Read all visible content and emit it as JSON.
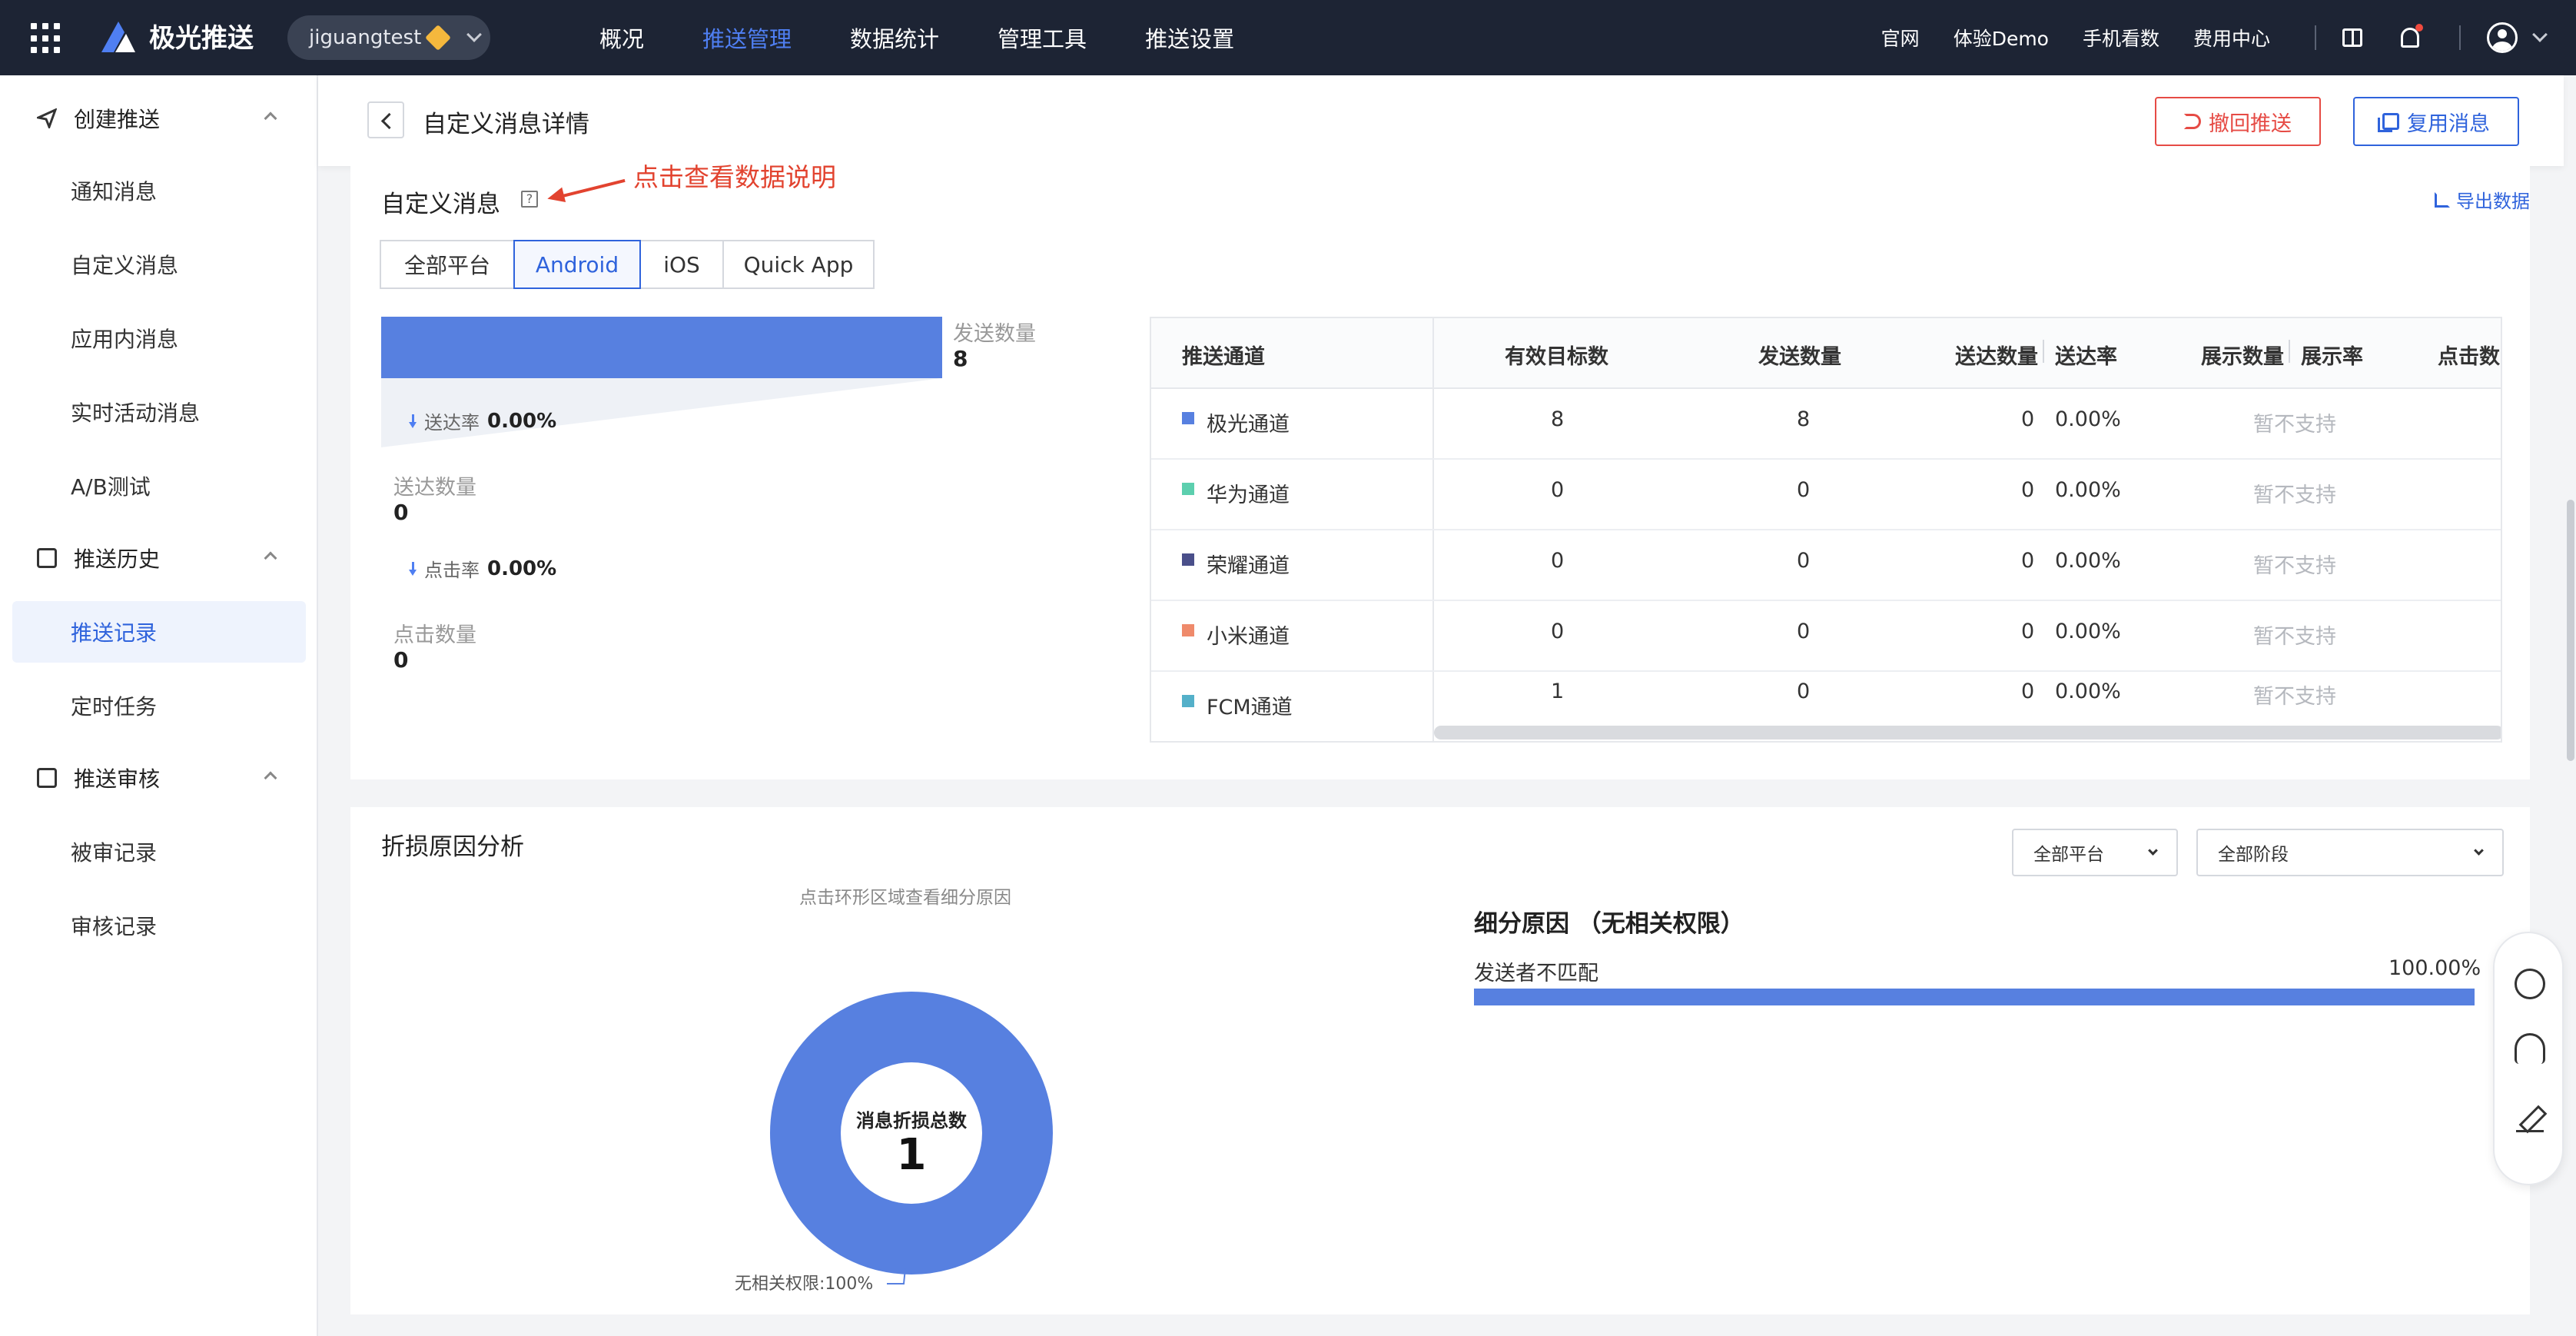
{
  "topbar": {
    "logo_text": "极光推送",
    "account": "jiguangtest",
    "nav": [
      "概况",
      "推送管理",
      "数据统计",
      "管理工具",
      "推送设置"
    ],
    "active_nav": "推送管理",
    "links": [
      "官网",
      "体验Demo",
      "手机看数",
      "费用中心"
    ]
  },
  "sidebar": {
    "groups": [
      {
        "title": "创建推送",
        "items": [
          "通知消息",
          "自定义消息",
          "应用内消息",
          "实时活动消息",
          "A/B测试"
        ]
      },
      {
        "title": "推送历史",
        "items": [
          "推送记录",
          "定时任务"
        ]
      },
      {
        "title": "推送审核",
        "items": [
          "被审记录",
          "审核记录"
        ]
      }
    ],
    "active_item": "推送记录"
  },
  "header": {
    "title": "自定义消息详情",
    "revoke_label": "撤回推送",
    "reuse_label": "复用消息"
  },
  "summary": {
    "title": "自定义消息",
    "help_glyph": "?",
    "annotation": "点击查看数据说明",
    "export_label": "导出数据",
    "tabs": [
      "全部平台",
      "Android",
      "iOS",
      "Quick App"
    ],
    "active_tab": "Android",
    "funnel": {
      "sent_label": "发送数量",
      "sent_value": "8",
      "delivery_rate_label": "送达率",
      "delivery_rate": "0.00%",
      "delivered_label": "送达数量",
      "delivered_value": "0",
      "click_rate_label": "点击率",
      "click_rate": "0.00%",
      "clicks_label": "点击数量",
      "clicks_value": "0"
    },
    "table": {
      "headers": [
        "推送通道",
        "有效目标数",
        "发送数量",
        "送达数量",
        "送达率",
        "展示数量",
        "展示率",
        "点击数"
      ],
      "rows": [
        {
          "channel": "极光通道",
          "color": "#5780e0",
          "targets": "8",
          "sent": "8",
          "delivered": "0",
          "rate": "0.00%",
          "display": "暂不支持"
        },
        {
          "channel": "华为通道",
          "color": "#5ccfae",
          "targets": "0",
          "sent": "0",
          "delivered": "0",
          "rate": "0.00%",
          "display": "暂不支持"
        },
        {
          "channel": "荣耀通道",
          "color": "#4a4f8a",
          "targets": "0",
          "sent": "0",
          "delivered": "0",
          "rate": "0.00%",
          "display": "暂不支持"
        },
        {
          "channel": "小米通道",
          "color": "#ef8a6b",
          "targets": "0",
          "sent": "0",
          "delivered": "0",
          "rate": "0.00%",
          "display": "暂不支持"
        },
        {
          "channel": "FCM通道",
          "color": "#54b0c9",
          "targets": "1",
          "sent": "0",
          "delivered": "0",
          "rate": "0.00%",
          "display": "暂不支持"
        }
      ]
    }
  },
  "loss": {
    "title": "折损原因分析",
    "hint": "点击环形区域查看细分原因",
    "platform_select": "全部平台",
    "stage_select": "全部阶段",
    "donut_label": "消息折损总数",
    "donut_total": "1",
    "legend": "无相关权限:100%",
    "detail_title": "细分原因 （无相关权限）",
    "reason_label": "发送者不匹配",
    "reason_pct_text": "100.00%",
    "reason_fraction": 1.0
  },
  "colors": {
    "accent": "#2f63dc",
    "danger": "#e64b45",
    "bar": "#5780e0",
    "nav_bg": "#1d2434"
  },
  "icons": [
    "grid-icon",
    "logo-icon",
    "gem-icon",
    "chevron-down-icon",
    "book-icon",
    "bell-icon",
    "user-icon",
    "send-icon",
    "history-icon",
    "audit-icon",
    "back-icon",
    "undo-icon",
    "copy-icon",
    "help-icon",
    "export-icon",
    "chat-icon",
    "support-icon",
    "edit-icon"
  ]
}
